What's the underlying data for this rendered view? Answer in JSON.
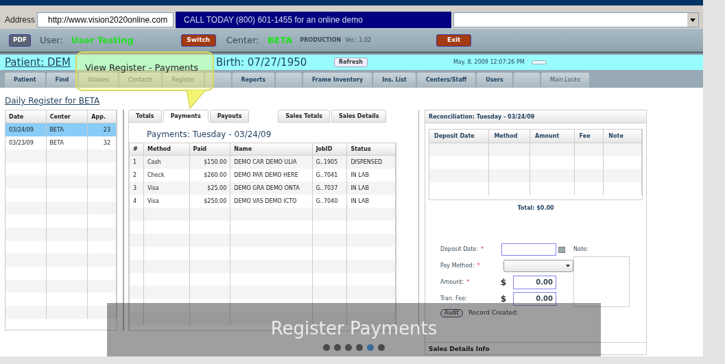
{
  "address": {
    "label": "Address",
    "url": "http://www.vision2020online.com",
    "banner": "CALL TODAY (800) 601-1455 for an online demo"
  },
  "user_bar": {
    "pdf_button": "PDF",
    "user_label": "User:",
    "user_name": "User Testing",
    "switch_button": "Switch",
    "center_label": "Center:",
    "center_name": "BETA",
    "environment": "PRODUCTION",
    "version": "Ver.: 1.02",
    "exit_button": "Exit"
  },
  "patient_bar": {
    "patient": "Patient: DEM",
    "birth": "Birth: 07/27/1950",
    "refresh_button": "Refresh",
    "datetime": "May. 8, 2009 12:07:26 PM"
  },
  "tooltip": "View Register - Payments",
  "nav_tabs": [
    {
      "kind": "tab",
      "label": "Patient",
      "disabled": false
    },
    {
      "kind": "tab",
      "label": "Find",
      "disabled": false
    },
    {
      "kind": "tab",
      "label": "Glasses",
      "disabled": true
    },
    {
      "kind": "tab",
      "label": "Contacts",
      "disabled": true
    },
    {
      "kind": "tab",
      "label": "Register",
      "disabled": true
    },
    {
      "kind": "blank"
    },
    {
      "kind": "tab",
      "label": "Reports",
      "disabled": false
    },
    {
      "kind": "blank"
    },
    {
      "kind": "tab",
      "label": "Frame Inventory",
      "disabled": false
    },
    {
      "kind": "tab",
      "label": "Ins. List",
      "disabled": false
    },
    {
      "kind": "tab",
      "label": "Centers/Staff",
      "disabled": false
    },
    {
      "kind": "tab",
      "label": "Users",
      "disabled": false
    },
    {
      "kind": "blank"
    },
    {
      "kind": "tab",
      "label": "Main Locks",
      "disabled": true
    }
  ],
  "register": {
    "title": "Daily Register for BETA",
    "columns": [
      "Date",
      "Center",
      "App."
    ],
    "rows": [
      {
        "cells": [
          "03/24/09",
          "BETA",
          "23"
        ],
        "selected": true
      },
      {
        "cells": [
          "03/23/09",
          "BETA",
          "32"
        ],
        "selected": false
      }
    ]
  },
  "payments": {
    "tabs": [
      {
        "label": "Totals",
        "selected": false
      },
      {
        "label": "Payments",
        "selected": true
      },
      {
        "label": "Payouts",
        "selected": false
      },
      {
        "label": "Sales Totals",
        "selected": false
      },
      {
        "label": "Sales Details",
        "selected": false
      }
    ],
    "title": "Payments: Tuesday - 03/24/09",
    "columns": [
      "#",
      "Method",
      "Paid",
      "Name",
      "JobID",
      "Status"
    ],
    "rows": [
      [
        "1",
        "Cash",
        "$150.00",
        "DEMO CAR DEMO ULIA",
        "G..1905",
        "DISPENSED"
      ],
      [
        "2",
        "Check",
        "$260.00",
        "DEMO PAR DEMO HERE",
        "G..7041",
        "IN LAB"
      ],
      [
        "3",
        "Visa",
        "$25.00",
        "DEMO GRA DEMO ONTA",
        "G..7037",
        "IN LAB"
      ],
      [
        "4",
        "Visa",
        "$250.00",
        "DEMO VAS DEMO ICTO",
        "G..7040",
        "IN LAB"
      ]
    ]
  },
  "reconciliation": {
    "title": "Reconciliation: Tuesday - 03/24/09",
    "columns": [
      "Deposit Date",
      "Method",
      "Amount",
      "Fee",
      "Note"
    ],
    "total": "Total: $0.00",
    "fields": [
      {
        "kind": "date",
        "label": "Deposit Date:",
        "marker": "*"
      },
      {
        "kind": "select",
        "label": "Pay Method:",
        "marker": "*"
      },
      {
        "kind": "money",
        "label": "Amount:",
        "marker": "*",
        "currency": "$",
        "value": "0.00"
      },
      {
        "kind": "money",
        "label": "Tran. Fee:",
        "currency": "$",
        "value": "0.00"
      }
    ],
    "note_label": "Note:",
    "audit_button": "Audit",
    "record_created": "Record Created:",
    "footer": "Sales Details Info"
  },
  "caption": {
    "title": "Register Payments",
    "dots": [
      {
        "selected": false
      },
      {
        "selected": false
      },
      {
        "selected": false
      },
      {
        "selected": false
      },
      {
        "selected": true
      },
      {
        "selected": false
      }
    ]
  }
}
